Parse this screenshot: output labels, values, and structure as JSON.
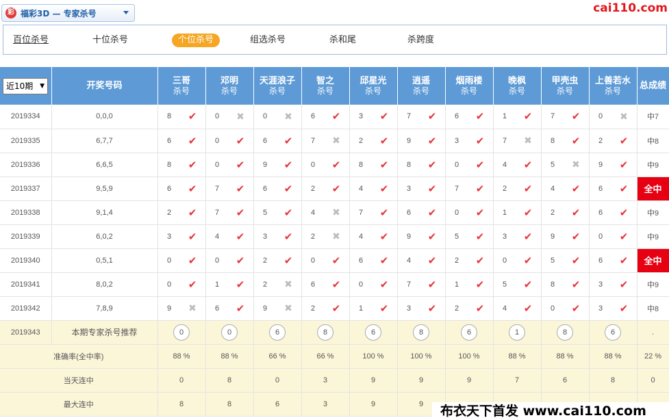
{
  "header": {
    "logo_char": "彩",
    "selector_text": "福彩3D — 专家杀号",
    "site_logo": "cai110.com"
  },
  "tabs": [
    "百位杀号",
    "十位杀号",
    "个位杀号",
    "组选杀号",
    "杀和尾",
    "杀跨度"
  ],
  "active_tab": "个位杀号",
  "table": {
    "period_select": "近10期",
    "draw_header": "开奖号码",
    "experts": [
      {
        "name": "三哥",
        "sub": "杀号"
      },
      {
        "name": "邓明",
        "sub": "杀号"
      },
      {
        "name": "天涯浪子",
        "sub": "杀号"
      },
      {
        "name": "智之",
        "sub": "杀号"
      },
      {
        "name": "邱星光",
        "sub": "杀号"
      },
      {
        "name": "逍遥",
        "sub": "杀号"
      },
      {
        "name": "烟雨楼",
        "sub": "杀号"
      },
      {
        "name": "晚枫",
        "sub": "杀号"
      },
      {
        "name": "甲壳虫",
        "sub": "杀号"
      },
      {
        "name": "上善若水",
        "sub": "杀号"
      }
    ],
    "result_header": "总成绩",
    "rows": [
      {
        "issue": "2019334",
        "draw": "0,0,0",
        "picks": [
          [
            "8",
            true
          ],
          [
            "0",
            false
          ],
          [
            "0",
            false
          ],
          [
            "6",
            true
          ],
          [
            "3",
            true
          ],
          [
            "7",
            true
          ],
          [
            "6",
            true
          ],
          [
            "1",
            true
          ],
          [
            "7",
            true
          ],
          [
            "0",
            false
          ]
        ],
        "result": "中7",
        "all_win": false
      },
      {
        "issue": "2019335",
        "draw": "6,7,7",
        "picks": [
          [
            "6",
            true
          ],
          [
            "0",
            true
          ],
          [
            "6",
            true
          ],
          [
            "7",
            false
          ],
          [
            "2",
            true
          ],
          [
            "9",
            true
          ],
          [
            "3",
            true
          ],
          [
            "7",
            false
          ],
          [
            "8",
            true
          ],
          [
            "2",
            true
          ]
        ],
        "result": "中8",
        "all_win": false
      },
      {
        "issue": "2019336",
        "draw": "6,6,5",
        "picks": [
          [
            "8",
            true
          ],
          [
            "0",
            true
          ],
          [
            "9",
            true
          ],
          [
            "0",
            true
          ],
          [
            "8",
            true
          ],
          [
            "8",
            true
          ],
          [
            "0",
            true
          ],
          [
            "4",
            true
          ],
          [
            "5",
            false
          ],
          [
            "9",
            true
          ]
        ],
        "result": "中9",
        "all_win": false
      },
      {
        "issue": "2019337",
        "draw": "9,5,9",
        "picks": [
          [
            "6",
            true
          ],
          [
            "7",
            true
          ],
          [
            "6",
            true
          ],
          [
            "2",
            true
          ],
          [
            "4",
            true
          ],
          [
            "3",
            true
          ],
          [
            "7",
            true
          ],
          [
            "2",
            true
          ],
          [
            "4",
            true
          ],
          [
            "6",
            true
          ]
        ],
        "result": "全中",
        "all_win": true
      },
      {
        "issue": "2019338",
        "draw": "9,1,4",
        "picks": [
          [
            "2",
            true
          ],
          [
            "7",
            true
          ],
          [
            "5",
            true
          ],
          [
            "4",
            false
          ],
          [
            "7",
            true
          ],
          [
            "6",
            true
          ],
          [
            "0",
            true
          ],
          [
            "1",
            true
          ],
          [
            "2",
            true
          ],
          [
            "6",
            true
          ]
        ],
        "result": "中9",
        "all_win": false
      },
      {
        "issue": "2019339",
        "draw": "6,0,2",
        "picks": [
          [
            "3",
            true
          ],
          [
            "4",
            true
          ],
          [
            "3",
            true
          ],
          [
            "2",
            false
          ],
          [
            "4",
            true
          ],
          [
            "9",
            true
          ],
          [
            "5",
            true
          ],
          [
            "3",
            true
          ],
          [
            "9",
            true
          ],
          [
            "0",
            true
          ]
        ],
        "result": "中9",
        "all_win": false
      },
      {
        "issue": "2019340",
        "draw": "0,5,1",
        "picks": [
          [
            "0",
            true
          ],
          [
            "0",
            true
          ],
          [
            "2",
            true
          ],
          [
            "0",
            true
          ],
          [
            "6",
            true
          ],
          [
            "4",
            true
          ],
          [
            "2",
            true
          ],
          [
            "0",
            true
          ],
          [
            "5",
            true
          ],
          [
            "6",
            true
          ]
        ],
        "result": "全中",
        "all_win": true
      },
      {
        "issue": "2019341",
        "draw": "8,0,2",
        "picks": [
          [
            "0",
            true
          ],
          [
            "1",
            true
          ],
          [
            "2",
            false
          ],
          [
            "6",
            true
          ],
          [
            "0",
            true
          ],
          [
            "7",
            true
          ],
          [
            "1",
            true
          ],
          [
            "5",
            true
          ],
          [
            "8",
            true
          ],
          [
            "3",
            true
          ]
        ],
        "result": "中9",
        "all_win": false
      },
      {
        "issue": "2019342",
        "draw": "7,8,9",
        "picks": [
          [
            "9",
            false
          ],
          [
            "6",
            true
          ],
          [
            "9",
            false
          ],
          [
            "2",
            true
          ],
          [
            "1",
            true
          ],
          [
            "3",
            true
          ],
          [
            "2",
            true
          ],
          [
            "4",
            true
          ],
          [
            "0",
            true
          ],
          [
            "3",
            true
          ]
        ],
        "result": "中8",
        "all_win": false
      }
    ],
    "recommend": {
      "issue": "2019343",
      "label": "本期专家杀号推荐",
      "values": [
        "0",
        "0",
        "6",
        "8",
        "6",
        "8",
        "6",
        "1",
        "8",
        "6"
      ],
      "result": "."
    },
    "stats": [
      {
        "label": "准确率(全中率)",
        "values": [
          "88 %",
          "88 %",
          "66 %",
          "66 %",
          "100 %",
          "100 %",
          "100 %",
          "88 %",
          "88 %",
          "88 %"
        ],
        "result": "22 %"
      },
      {
        "label": "当天连中",
        "values": [
          "0",
          "8",
          "0",
          "3",
          "9",
          "9",
          "9",
          "7",
          "6",
          "8"
        ],
        "result": "0"
      },
      {
        "label": "最大连中",
        "values": [
          "8",
          "8",
          "6",
          "3",
          "9",
          "9",
          "",
          "",
          "",
          "",
          ""
        ],
        "result": ""
      }
    ]
  },
  "banner_text": "布衣天下首发 www.cai110.com",
  "icons": {
    "hit": "check-icon",
    "miss": "cross-icon"
  },
  "colors": {
    "header_blue": "#5d9ad6",
    "hit_red": "#e8343c",
    "allwin_red": "#e60012",
    "tab_orange": "#f5a623"
  }
}
